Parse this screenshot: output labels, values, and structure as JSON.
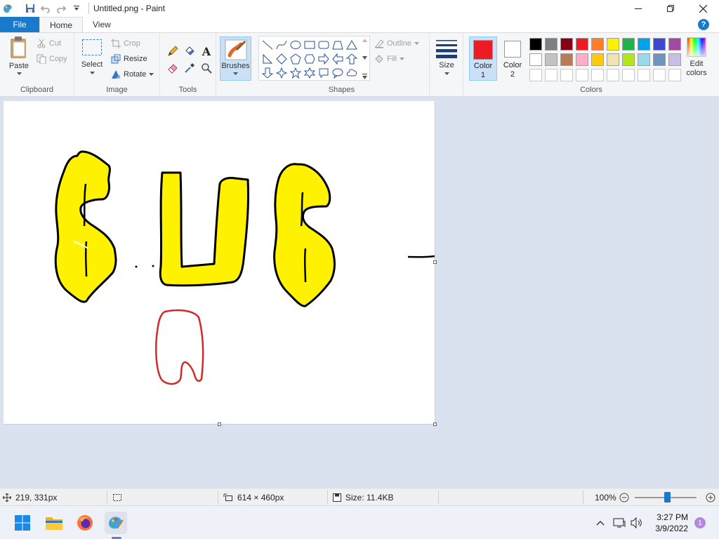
{
  "window": {
    "title": "Untitled.png - Paint"
  },
  "tabs": {
    "file": "File",
    "home": "Home",
    "view": "View"
  },
  "help": "?",
  "clipboard": {
    "paste": "Paste",
    "cut": "Cut",
    "copy": "Copy",
    "group": "Clipboard"
  },
  "image": {
    "select": "Select",
    "crop": "Crop",
    "resize": "Resize",
    "rotate": "Rotate",
    "group": "Image"
  },
  "tools": {
    "group": "Tools",
    "text_tool_glyph": "A"
  },
  "brushes": {
    "label": "Brushes"
  },
  "shapes": {
    "outline": "Outline",
    "fill": "Fill",
    "group": "Shapes"
  },
  "size": {
    "label": "Size"
  },
  "colors": {
    "color1_label": "Color 1",
    "color1_line1": "Color",
    "color1_line2": "1",
    "color2_line1": "Color",
    "color2_line2": "2",
    "color1_value": "#ed1c24",
    "color2_value": "#ffffff",
    "edit_line1": "Edit",
    "edit_line2": "colors",
    "group": "Colors",
    "palette_row1": [
      "#000000",
      "#7f7f7f",
      "#880015",
      "#ed1c24",
      "#ff7f27",
      "#fff200",
      "#22b14c",
      "#00a2e8",
      "#3f48cc",
      "#a349a4"
    ],
    "palette_row2": [
      "#ffffff",
      "#c3c3c3",
      "#b97a57",
      "#ffaec9",
      "#ffc90e",
      "#efe4b0",
      "#b5e61d",
      "#99d9ea",
      "#7092be",
      "#c8bfe7"
    ]
  },
  "statusbar": {
    "cursor_pos": "219, 331px",
    "canvas_size": "614 × 460px",
    "file_size": "Size: 11.4KB",
    "zoom": "100%",
    "zoom_percent": 100
  },
  "taskbar": {
    "time": "3:27 PM",
    "date": "3/9/2022",
    "notifications": "1"
  }
}
